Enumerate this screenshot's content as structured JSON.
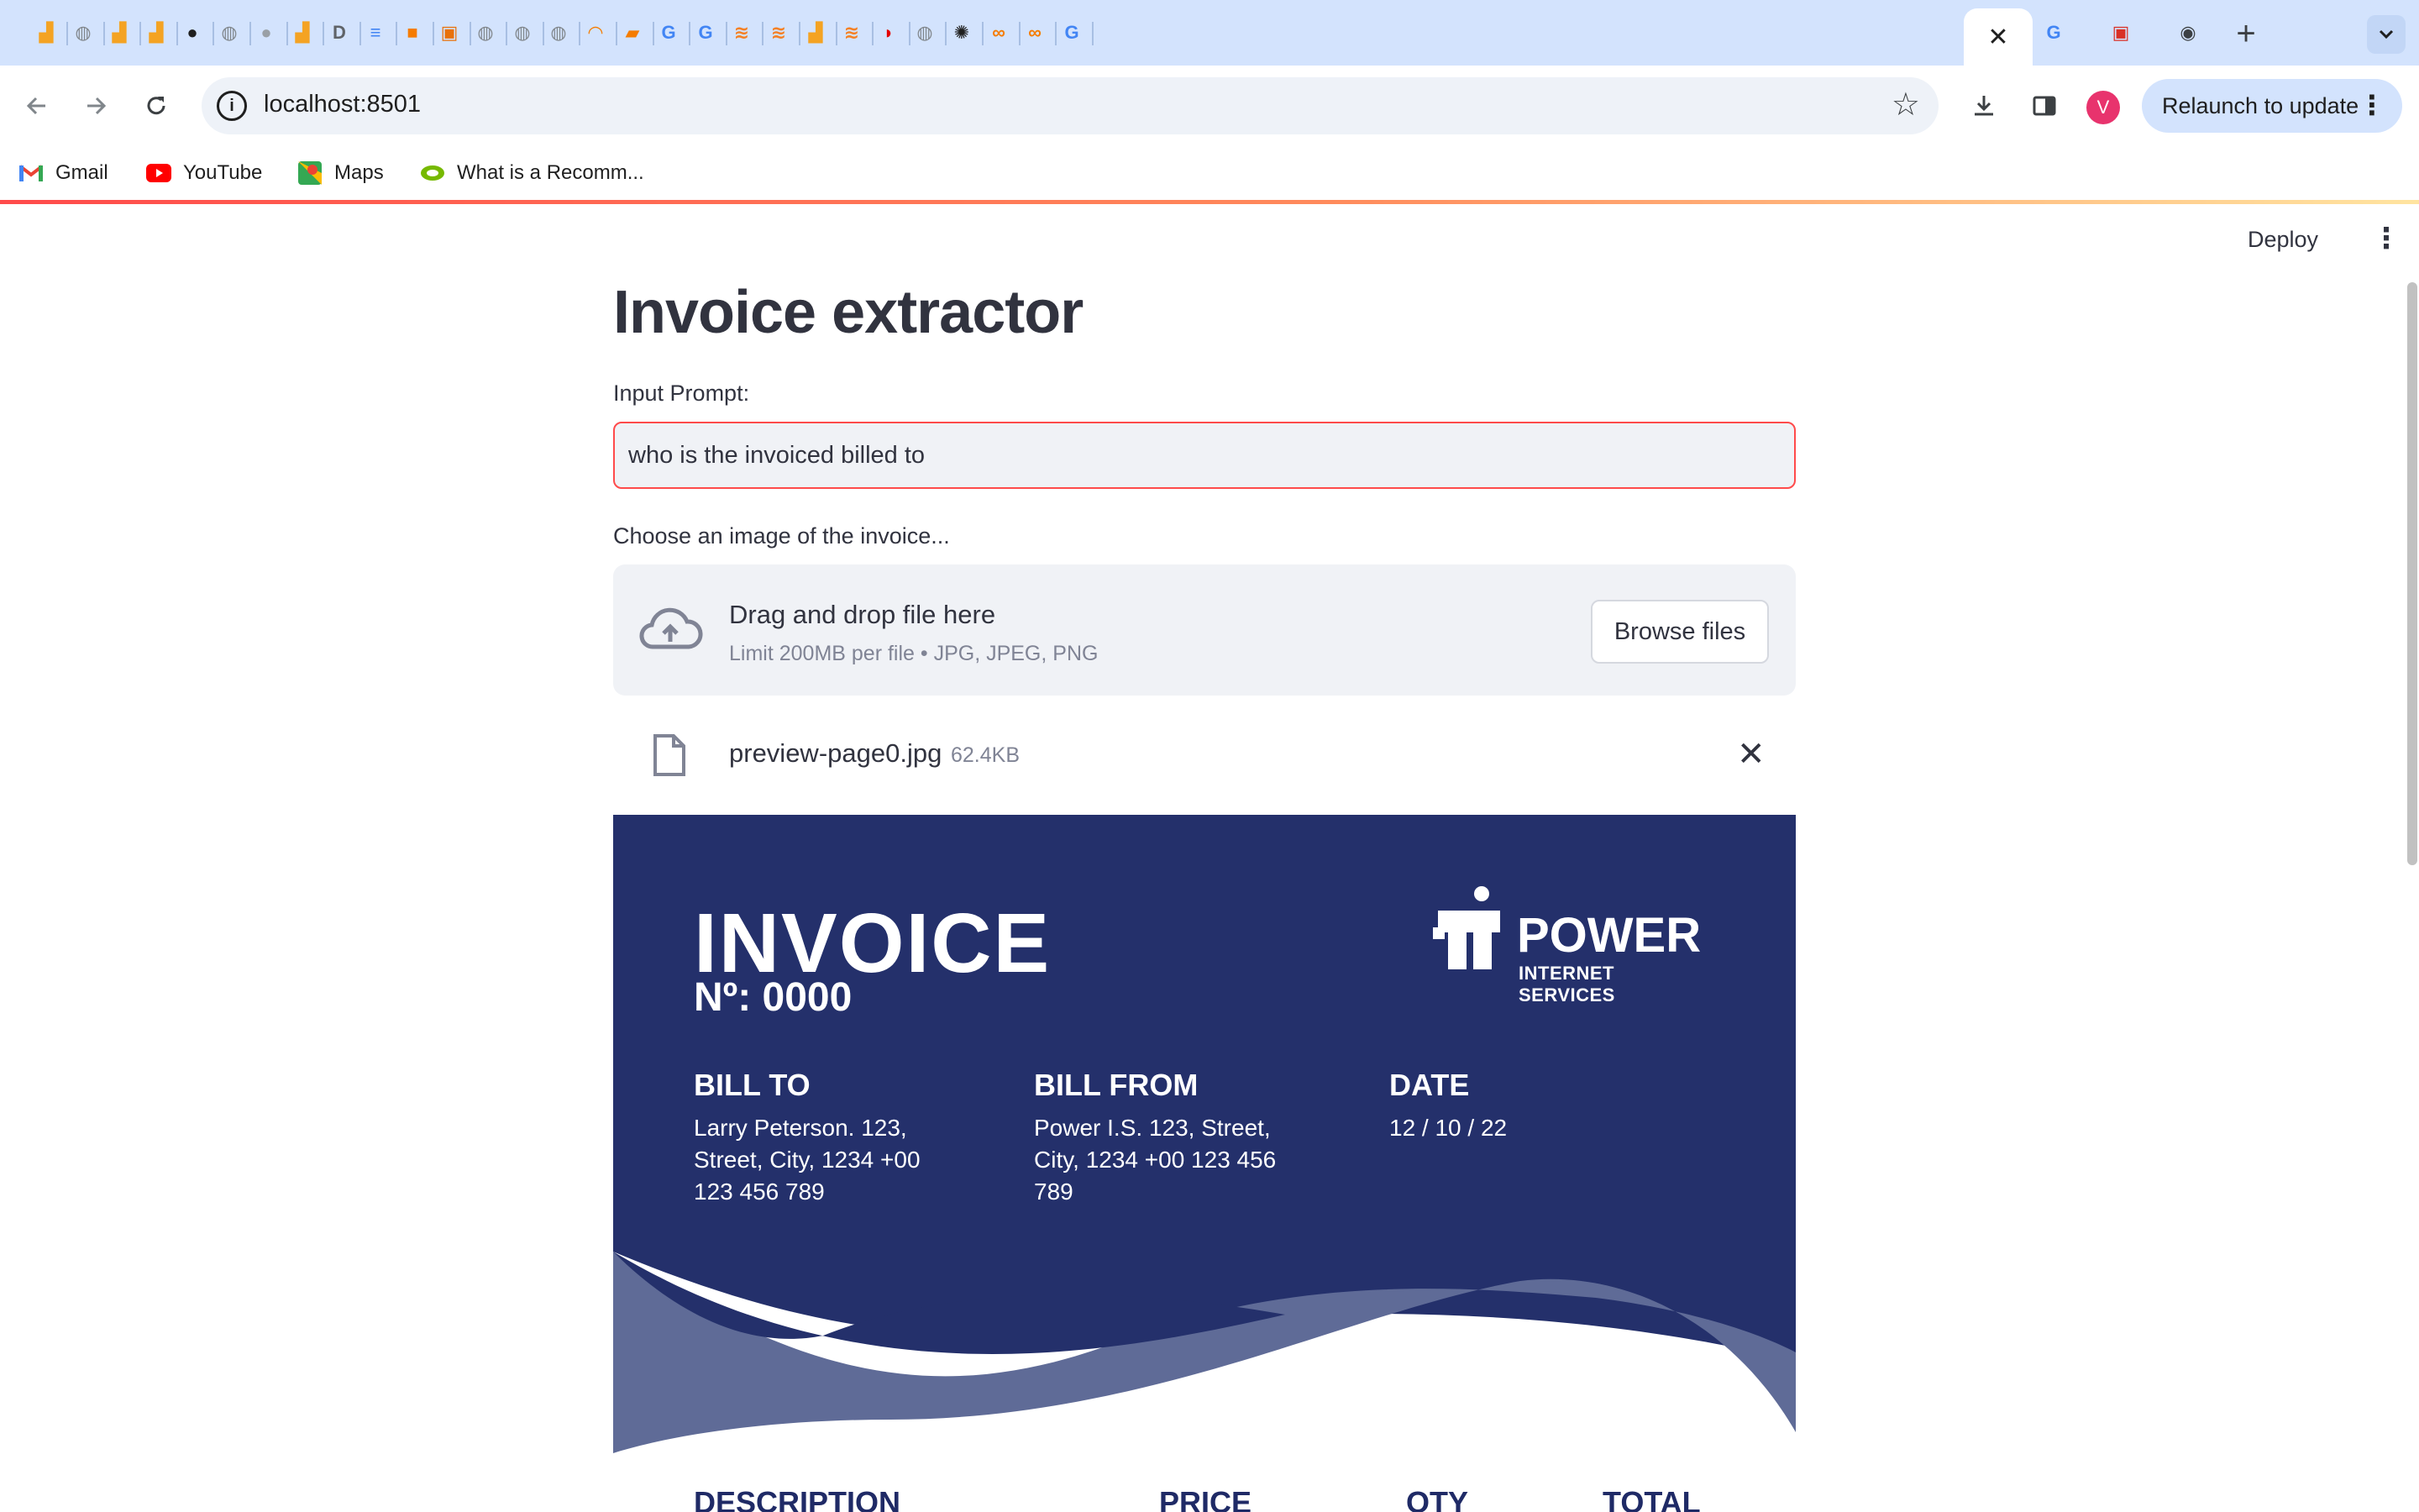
{
  "browser": {
    "tabs": [
      {
        "icon": "analytics-icon",
        "color": "#f4a323"
      },
      {
        "icon": "globe-icon",
        "color": "#80868b"
      },
      {
        "icon": "analytics-icon",
        "color": "#f4a323"
      },
      {
        "icon": "analytics-icon",
        "color": "#f4a323"
      },
      {
        "icon": "github-icon",
        "color": "#1f1f1f"
      },
      {
        "icon": "globe-icon",
        "color": "#80868b"
      },
      {
        "icon": "github-icon",
        "color": "#9aa0a6"
      },
      {
        "icon": "analytics-icon",
        "color": "#f4a323"
      },
      {
        "icon": "letter-d-icon",
        "color": "#5f6368"
      },
      {
        "icon": "docs-icon",
        "color": "#4285f4"
      },
      {
        "icon": "cube-icon",
        "color": "#f57c00"
      },
      {
        "icon": "box-icon",
        "color": "#e8710a"
      },
      {
        "icon": "globe-icon",
        "color": "#80868b"
      },
      {
        "icon": "globe-icon",
        "color": "#80868b"
      },
      {
        "icon": "globe-icon",
        "color": "#80868b"
      },
      {
        "icon": "loader-icon",
        "color": "#f57c00"
      },
      {
        "icon": "book-icon",
        "color": "#f57c00"
      },
      {
        "icon": "google-icon",
        "color": "#4285f4"
      },
      {
        "icon": "google-icon",
        "color": "#4285f4"
      },
      {
        "icon": "stackoverflow-icon",
        "color": "#f48024"
      },
      {
        "icon": "stackoverflow-icon",
        "color": "#f48024"
      },
      {
        "icon": "analytics-icon",
        "color": "#f4a323"
      },
      {
        "icon": "stackoverflow-icon",
        "color": "#f48024"
      },
      {
        "icon": "airtel-icon",
        "color": "#e40000"
      },
      {
        "icon": "globe-icon",
        "color": "#80868b"
      },
      {
        "icon": "openai-icon",
        "color": "#1f1f1f"
      },
      {
        "icon": "infinity-icon",
        "color": "#f57c00"
      },
      {
        "icon": "infinity-icon",
        "color": "#f57c00"
      },
      {
        "icon": "google-icon",
        "color": "#4285f4"
      }
    ],
    "active_tab_close": "✕",
    "after_tabs": [
      {
        "icon": "google-icon",
        "color": "#4285f4"
      },
      {
        "icon": "bookmark-red-icon",
        "color": "#d93025"
      },
      {
        "icon": "chrome-icon",
        "color": "#3c4043"
      }
    ],
    "new_tab": "+",
    "url": "localhost:8501",
    "profile_initial": "V",
    "relaunch_label": "Relaunch to update",
    "bookmarks": [
      {
        "label": "Gmail",
        "icon": "gmail-icon"
      },
      {
        "label": "YouTube",
        "icon": "youtube-icon"
      },
      {
        "label": "Maps",
        "icon": "maps-icon"
      },
      {
        "label": "What is a Recomm...",
        "icon": "nvidia-icon"
      }
    ]
  },
  "app": {
    "deploy_label": "Deploy",
    "title": "Invoice extractor",
    "prompt_label": "Input Prompt:",
    "prompt_value": "who is the invoiced billed to",
    "upload_label": "Choose an image of the invoice...",
    "dropzone_title": "Drag and drop file here",
    "dropzone_limit": "Limit 200MB per file • JPG, JPEG, PNG",
    "browse_label": "Browse files",
    "file_name": "preview-page0.jpg",
    "file_size": "62.4KB"
  },
  "invoice": {
    "title": "INVOICE",
    "number": "Nº: 0000",
    "brand": "POWER",
    "brand_sub": "INTERNET SERVICES",
    "bill_to_heading": "BILL TO",
    "bill_to_text": "Larry Peterson. 123,\nStreet, City, 1234 +00\n123 456 789",
    "bill_from_heading": "BILL FROM",
    "bill_from_text": "Power I.S. 123, Street,\nCity, 1234 +00 123 456\n789",
    "date_heading": "DATE",
    "date_text": "12 / 10 / 22",
    "columns": [
      "DESCRIPTION",
      "PRICE",
      "QTY",
      "TOTAL"
    ],
    "colors": {
      "navy": "#24306b",
      "wave": "#5f6b97",
      "text_dark": "#1f2a66"
    }
  }
}
